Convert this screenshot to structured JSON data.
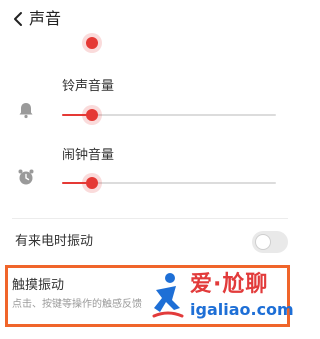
{
  "header": {
    "title": "声音",
    "back_icon": "chevron-left-icon"
  },
  "sliders": [
    {
      "label": "",
      "icon": "",
      "value": 0.2
    },
    {
      "label": "铃声音量",
      "icon": "bell-icon",
      "value": 0.2
    },
    {
      "label": "闹钟音量",
      "icon": "alarm-clock-icon",
      "value": 0.2
    }
  ],
  "vibrate_on_ring": {
    "label": "有来电时振动",
    "enabled": false
  },
  "haptic": {
    "title": "触摸振动",
    "description": "点击、按键等操作的触感反馈"
  },
  "watermark": {
    "title": "爱·尬聊",
    "url": "igaliao.com"
  },
  "colors": {
    "accent": "#e53935",
    "highlight": "#f0652a",
    "watermark_red": "#e23b3b",
    "watermark_blue": "#1e6fd6"
  }
}
